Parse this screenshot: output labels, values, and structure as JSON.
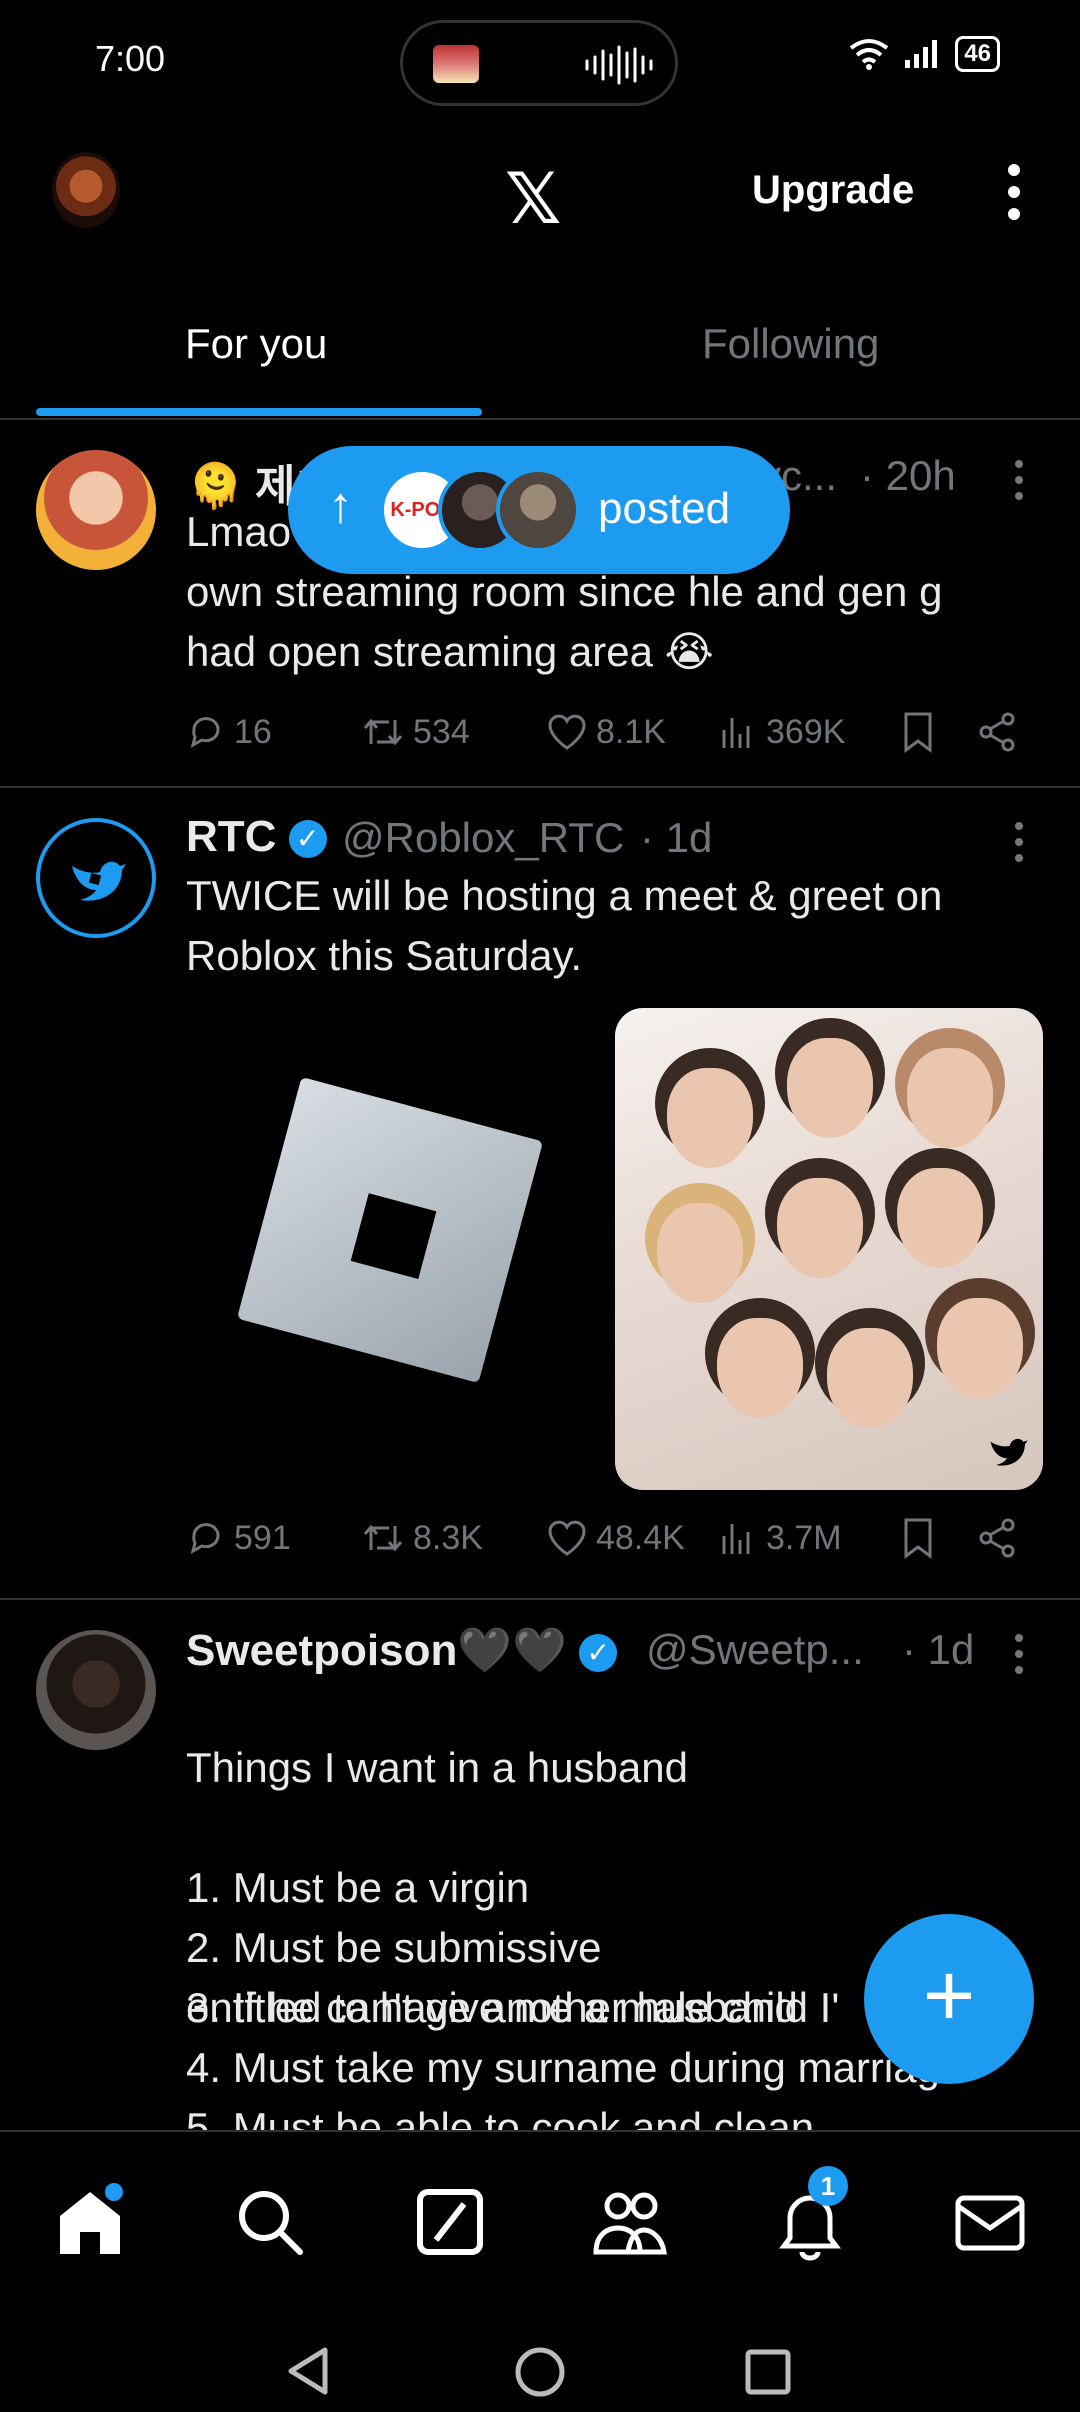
{
  "status_bar": {
    "time": "7:00",
    "battery": "46"
  },
  "header": {
    "logo": "𝕏",
    "upgrade_label": "Upgrade"
  },
  "tabs": [
    {
      "label": "For you"
    },
    {
      "label": "Following"
    }
  ],
  "posted_pill": {
    "label": "posted",
    "avatar_text": "K-POP"
  },
  "tweets": [
    {
      "name": "제!",
      "handle": "yc...",
      "time": "· 20h",
      "text": "Lmao                                          e has his\nown streaming room since hle and gen g\nhad open streaming area 😭",
      "replies": "16",
      "retweets": "534",
      "likes": "8.1K",
      "views": "369K"
    },
    {
      "name": "RTC",
      "handle": "@Roblox_RTC",
      "time": "· 1d",
      "text": "TWICE will be hosting a meet & greet on\nRoblox this Saturday.",
      "replies": "591",
      "retweets": "8.3K",
      "likes": "48.4K",
      "views": "3.7M"
    },
    {
      "name": "Sweetpoison🖤🖤",
      "handle": "@Sweetp...",
      "time": "· 1d",
      "text": "Things I want in a husband\n\n1. Must be a virgin\n2. Must be submissive\n3. If he can't give me a male child I'",
      "line_b": "entitled to have another husband",
      "line_c": "4. Must take my surname during marriage",
      "line_d": "5. Must be able to cook and clean"
    }
  ],
  "notifications_badge": "1",
  "colors": {
    "accent": "#1d9bf0",
    "background": "#000000",
    "muted": "#71767b"
  }
}
